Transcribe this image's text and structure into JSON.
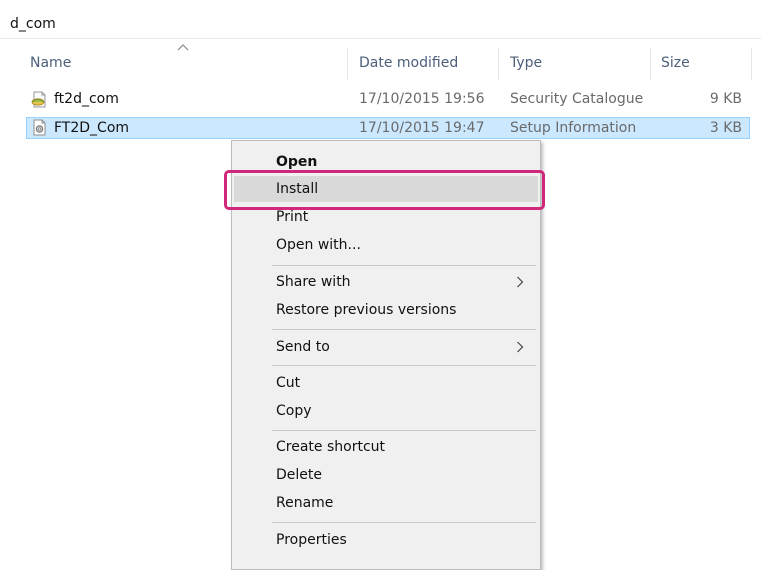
{
  "location": {
    "path_title": "d_com"
  },
  "columns": {
    "name": "Name",
    "date_modified": "Date modified",
    "type": "Type",
    "size": "Size",
    "sorted_by": "Name",
    "sort_direction": "ascending"
  },
  "files": [
    {
      "name": "ft2d_com",
      "date_modified": "17/10/2015 19:56",
      "type": "Security Catalogue",
      "size": "9 KB",
      "icon": "security-catalogue-icon",
      "selected": false
    },
    {
      "name": "FT2D_Com",
      "date_modified": "17/10/2015 19:47",
      "type": "Setup Information",
      "size": "3 KB",
      "icon": "setup-information-icon",
      "selected": true
    }
  ],
  "context_menu": {
    "items": [
      {
        "label": "Open",
        "bold": true
      },
      {
        "label": "Install",
        "highlighted": true
      },
      {
        "label": "Print"
      },
      {
        "label": "Open with..."
      },
      {
        "label": "Share with",
        "has_submenu": true
      },
      {
        "label": "Restore previous versions"
      },
      {
        "label": "Send to",
        "has_submenu": true
      },
      {
        "label": "Cut"
      },
      {
        "label": "Copy"
      },
      {
        "label": "Create shortcut"
      },
      {
        "label": "Delete"
      },
      {
        "label": "Rename"
      },
      {
        "label": "Properties"
      }
    ]
  },
  "colors": {
    "selection_fill": "#cce8ff",
    "selection_border": "#99d1ff",
    "highlight_box": "#d0277a",
    "menu_background": "#f0f0f0",
    "menu_hover": "#d9d9d9",
    "column_header_text": "#4c607a"
  }
}
